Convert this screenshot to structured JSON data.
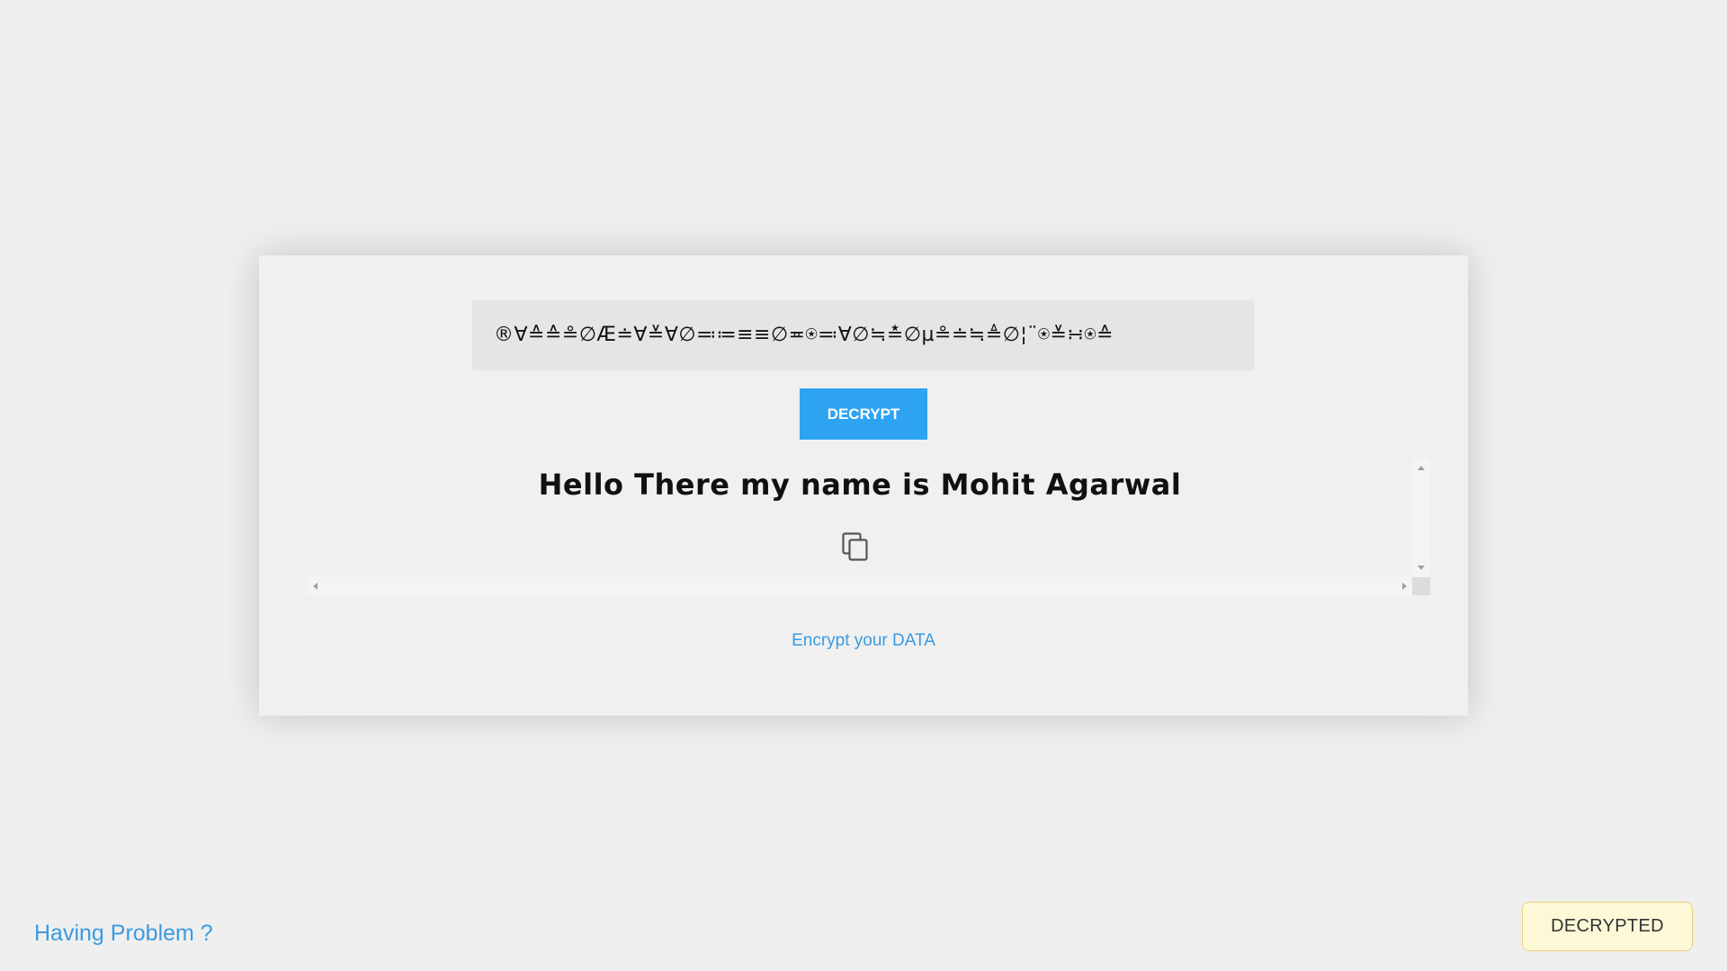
{
  "cipher_input": {
    "value": "®∀≙≙≗∅Æ≐∀≚∀∅≕≔≡≡∅≖⍟≕∀∅≒≛∅µ≗≐≒≜∅¦¨⍟≚∺⍟≙"
  },
  "decrypt_button": {
    "label": "DECRYPT"
  },
  "output": {
    "text": "Hello There my name is Mohit Agarwal"
  },
  "icons": {
    "copy": "copy-icon"
  },
  "links": {
    "encrypt": "Encrypt your DATA",
    "help": "Having Problem ?"
  },
  "status": {
    "label": "DECRYPTED"
  },
  "colors": {
    "accent": "#2ea3f2",
    "link": "#3a9be0",
    "badge_bg": "#fdf8d7",
    "badge_border": "#eccf7a"
  }
}
